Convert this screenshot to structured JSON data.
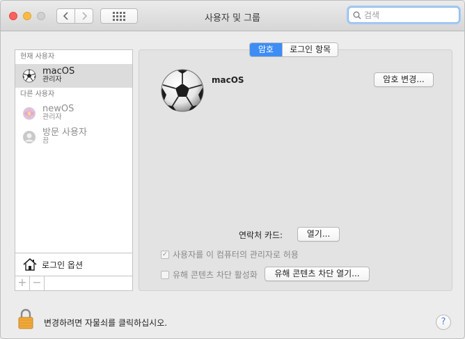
{
  "window": {
    "title": "사용자 및 그룹"
  },
  "toolbar": {
    "back_icon": "chevron-left-icon",
    "forward_icon": "chevron-right-icon",
    "grid_icon": "grid-icon",
    "search_placeholder": "검색"
  },
  "sidebar": {
    "current_section": "현재 사용자",
    "other_section": "다른 사용자",
    "current_user": {
      "name": "macOS",
      "role": "관리자",
      "avatar_icon": "soccer-ball-icon"
    },
    "other_users": [
      {
        "name": "newOS",
        "role": "관리자",
        "avatar_icon": "flower-avatar-icon"
      },
      {
        "name": "방문 사용자",
        "role": "끔",
        "avatar_icon": "guest-avatar-icon"
      }
    ],
    "login_options": "로그인 옵션",
    "add_label": "+",
    "remove_label": "−"
  },
  "main": {
    "tabs": [
      {
        "label": "암호",
        "active": true
      },
      {
        "label": "로그인 항목",
        "active": false
      }
    ],
    "user_name": "macOS",
    "change_password_button": "암호 변경...",
    "contact_card_label": "연락처 카드:",
    "open_contact_button": "열기...",
    "allow_admin_label": "사용자를 이 컴퓨터의 관리자로 허용",
    "allow_admin_checked": true,
    "parental_label": "유해 콘텐츠 차단 활성화",
    "parental_checked": false,
    "open_parental_button": "유해 콘텐츠 차단 열기..."
  },
  "footer": {
    "lock_text": "변경하려면 자물쇠를 클릭하십시오.",
    "help_label": "?"
  },
  "colors": {
    "accent": "#3d8df5",
    "close": "#fc615d",
    "minimize": "#fdbc40"
  }
}
